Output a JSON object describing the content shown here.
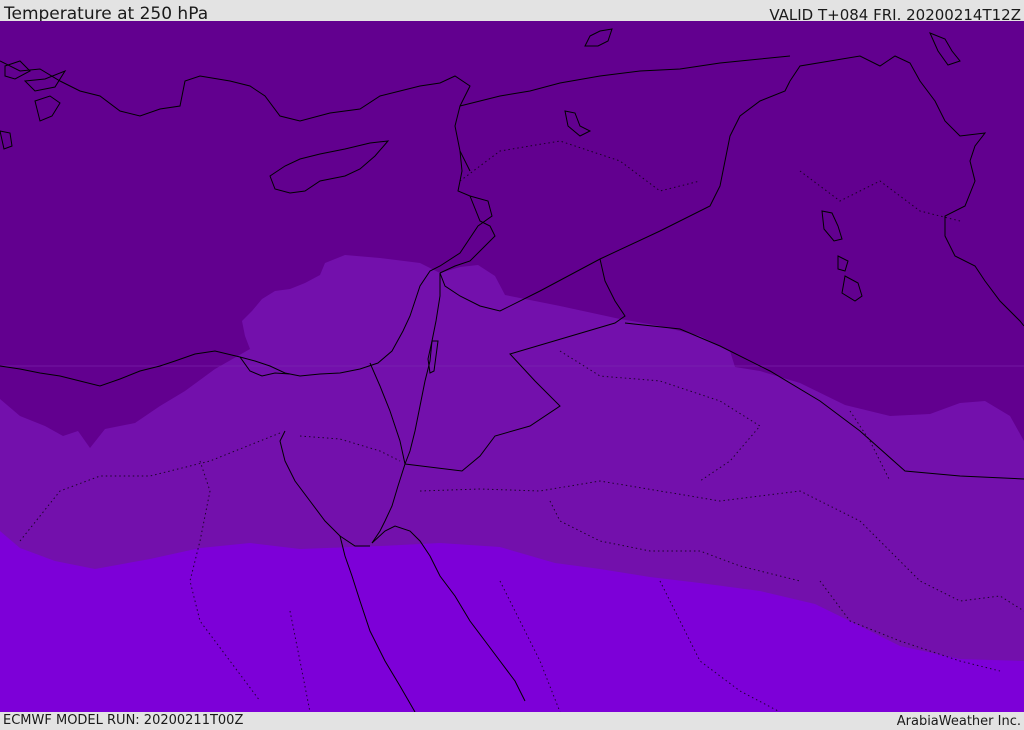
{
  "header": {
    "title": "Temperature at 250 hPa",
    "valid": "VALID T+084 FRI. 20200214T12Z"
  },
  "footer": {
    "model_run": "ECMWF MODEL RUN: 20200211T00Z",
    "provider": "ArabiaWeather Inc."
  },
  "colors": {
    "band_cold": "#62008f",
    "band_mid": "#7310ac",
    "band_warm": "#7d00d8",
    "coastline": "#000000",
    "bar_background": "#e3e3e3"
  }
}
